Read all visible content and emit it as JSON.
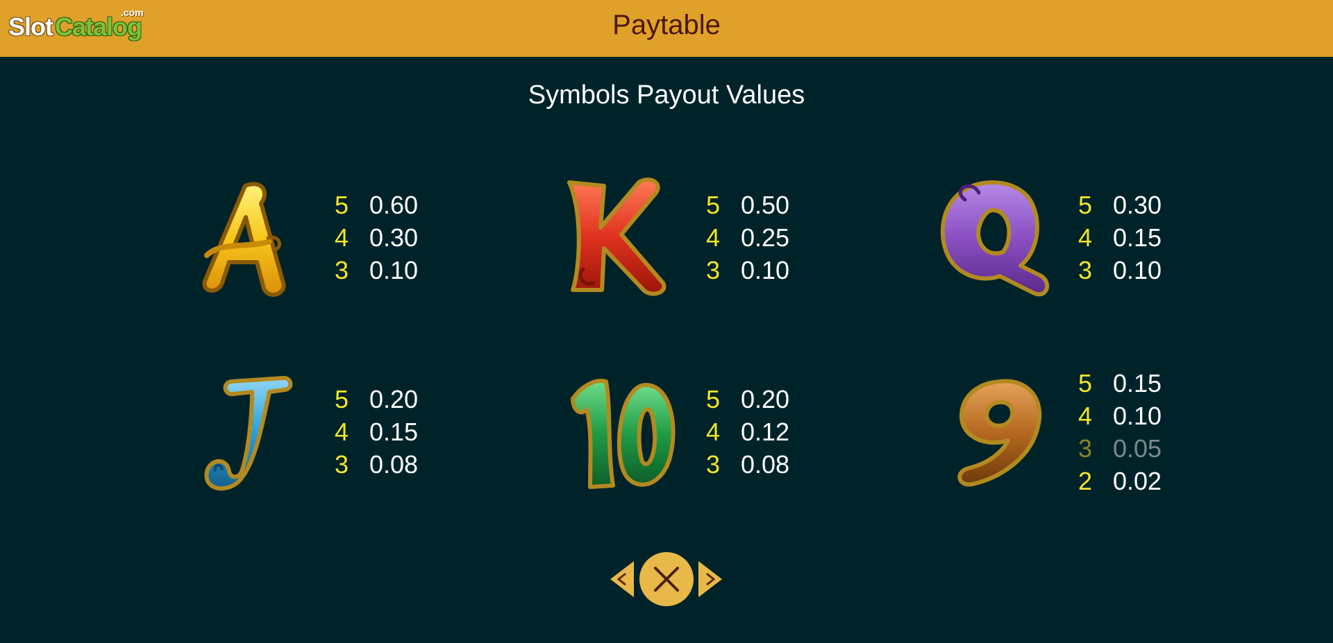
{
  "logo": {
    "part1": "Slot",
    "part2": "Catalog",
    "suffix": ".com"
  },
  "header": {
    "title": "Paytable"
  },
  "main": {
    "subtitle": "Symbols Payout Values"
  },
  "symbols": [
    {
      "id": "A",
      "icon": "letter-a-icon",
      "color": "#f7c51a",
      "pays": [
        {
          "count": "5",
          "value": "0.60"
        },
        {
          "count": "4",
          "value": "0.30"
        },
        {
          "count": "3",
          "value": "0.10"
        }
      ]
    },
    {
      "id": "K",
      "icon": "letter-k-icon",
      "color": "#e0321f",
      "pays": [
        {
          "count": "5",
          "value": "0.50"
        },
        {
          "count": "4",
          "value": "0.25"
        },
        {
          "count": "3",
          "value": "0.10"
        }
      ]
    },
    {
      "id": "Q",
      "icon": "letter-q-icon",
      "color": "#8a4fc2",
      "pays": [
        {
          "count": "5",
          "value": "0.30"
        },
        {
          "count": "4",
          "value": "0.15"
        },
        {
          "count": "3",
          "value": "0.10"
        }
      ]
    },
    {
      "id": "J",
      "icon": "letter-j-icon",
      "color": "#2a9ed8",
      "pays": [
        {
          "count": "5",
          "value": "0.20"
        },
        {
          "count": "4",
          "value": "0.15"
        },
        {
          "count": "3",
          "value": "0.08"
        }
      ]
    },
    {
      "id": "10",
      "icon": "number-10-icon",
      "color": "#1f9a45",
      "pays": [
        {
          "count": "5",
          "value": "0.20"
        },
        {
          "count": "4",
          "value": "0.12"
        },
        {
          "count": "3",
          "value": "0.08"
        }
      ]
    },
    {
      "id": "9",
      "icon": "number-9-icon",
      "color": "#b5681f",
      "pays": [
        {
          "count": "5",
          "value": "0.15"
        },
        {
          "count": "4",
          "value": "0.10"
        },
        {
          "count": "3",
          "value": "0.05"
        },
        {
          "count": "2",
          "value": "0.02"
        }
      ]
    }
  ],
  "navigation": {
    "prev_icon": "chevron-left-icon",
    "close_icon": "close-icon",
    "next_icon": "chevron-right-icon",
    "button_color": "#e8b948"
  }
}
